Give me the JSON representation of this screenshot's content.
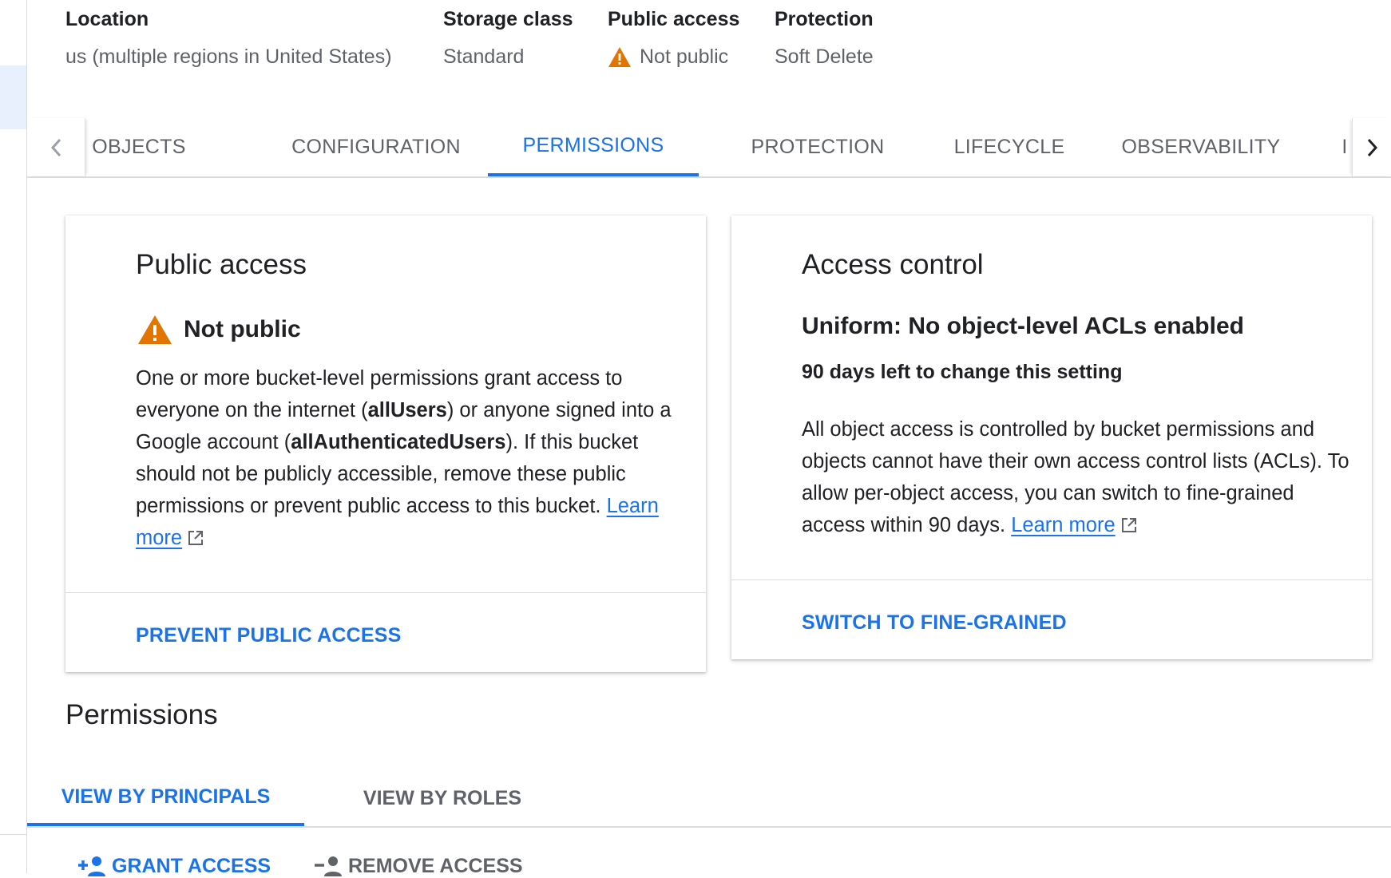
{
  "bucket_info": {
    "location": {
      "label": "Location",
      "value": "us (multiple regions in United States)"
    },
    "storage_class": {
      "label": "Storage class",
      "value": "Standard"
    },
    "public_access": {
      "label": "Public access",
      "value": "Not public",
      "icon": "warning-icon"
    },
    "protection": {
      "label": "Protection",
      "value": "Soft Delete"
    }
  },
  "tabs": [
    {
      "label": "OBJECTS",
      "active": false
    },
    {
      "label": "CONFIGURATION",
      "active": false
    },
    {
      "label": "PERMISSIONS",
      "active": true
    },
    {
      "label": "PROTECTION",
      "active": false
    },
    {
      "label": "LIFECYCLE",
      "active": false
    },
    {
      "label": "OBSERVABILITY",
      "active": false
    },
    {
      "label": "I",
      "active": false
    }
  ],
  "public_access_card": {
    "title": "Public access",
    "status": "Not public",
    "text_1": "One or more bucket-level permissions grant access to everyone on the internet (",
    "bold_1": "allUsers",
    "text_2": ") or anyone signed into a Google account (",
    "bold_2": "allAuthenticatedUsers",
    "text_3": "). If this bucket should not be publicly accessible, remove these public permissions or prevent public access to this bucket. ",
    "learn_more": "Learn more",
    "action": "PREVENT PUBLIC ACCESS"
  },
  "access_control_card": {
    "title": "Access control",
    "subtitle": "Uniform: No object-level ACLs enabled",
    "days_left": "90 days left to change this setting",
    "description": "All object access is controlled by bucket permissions and objects cannot have their own access control lists (ACLs). To allow per-object access, you can switch to fine-grained access within 90 days. ",
    "learn_more": "Learn more",
    "action": "SWITCH TO FINE-GRAINED"
  },
  "permissions": {
    "title": "Permissions",
    "subtabs": [
      {
        "label": "VIEW BY PRINCIPALS",
        "active": true
      },
      {
        "label": "VIEW BY ROLES",
        "active": false
      }
    ],
    "grant_access": "GRANT ACCESS",
    "remove_access": "REMOVE ACCESS"
  },
  "colors": {
    "accent": "#1a73e8",
    "warning": "#e37400",
    "muted": "#5f6368"
  }
}
